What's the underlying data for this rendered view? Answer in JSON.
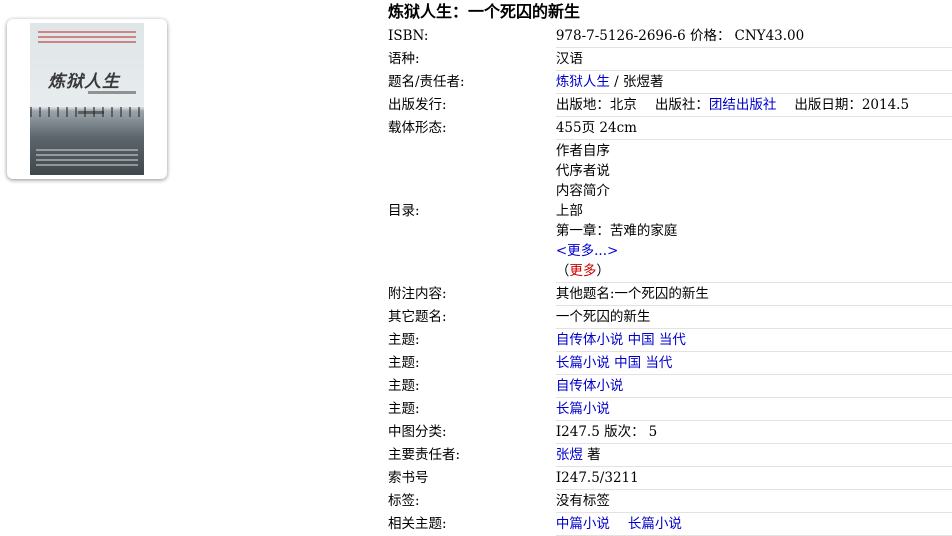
{
  "book": {
    "title": "炼狱人生：一个死囚的新生"
  },
  "cover": {
    "title": "炼狱人生"
  },
  "fields": {
    "isbn": {
      "label": "ISBN:",
      "value": "978-7-5126-2696-6",
      "price_label": "价格：",
      "price": "CNY43.00"
    },
    "language": {
      "label": "语种:",
      "value": "汉语"
    },
    "title_resp": {
      "label": "题名/责任者:",
      "title_link": "炼狱人生",
      "sep": "/",
      "author": "张煜著"
    },
    "publication": {
      "label": "出版发行:",
      "place_label": "出版地：",
      "place": "北京",
      "publisher_label": "出版社：",
      "publisher": "团结出版社",
      "date_label": "出版日期：",
      "date": "2014.5"
    },
    "physical": {
      "label": "载体形态:",
      "value": "455页 24cm"
    },
    "toc": {
      "label": "目录:",
      "items": [
        "作者自序",
        "代序者说",
        "内容简介",
        "上部",
        "第一章：苦难的家庭"
      ],
      "more_link": "<更多...>",
      "more_open": "（",
      "more_red": "更多",
      "more_close": "）"
    },
    "notes": {
      "label": "附注内容:",
      "value": "其他题名:一个死囚的新生"
    },
    "other_title": {
      "label": "其它题名:",
      "value": "一个死囚的新生"
    },
    "subjects": [
      {
        "label": "主题:",
        "value": "自传体小说 中国 当代"
      },
      {
        "label": "主题:",
        "value": "长篇小说 中国 当代"
      },
      {
        "label": "主题:",
        "value": "自传体小说"
      },
      {
        "label": "主题:",
        "value": "长篇小说"
      }
    ],
    "clc": {
      "label": "中图分类:",
      "value": "I247.5",
      "edition_label": "版次：",
      "edition": "5"
    },
    "main_resp": {
      "label": "主要责任者:",
      "link": "张煜",
      "suffix": "著"
    },
    "call_number": {
      "label": "索书号",
      "value": "I247.5/3211"
    },
    "tags": {
      "label": "标签:",
      "value": "没有标签"
    },
    "related": {
      "label": "相关主题:",
      "items": [
        "中篇小说",
        "长篇小说"
      ]
    }
  }
}
